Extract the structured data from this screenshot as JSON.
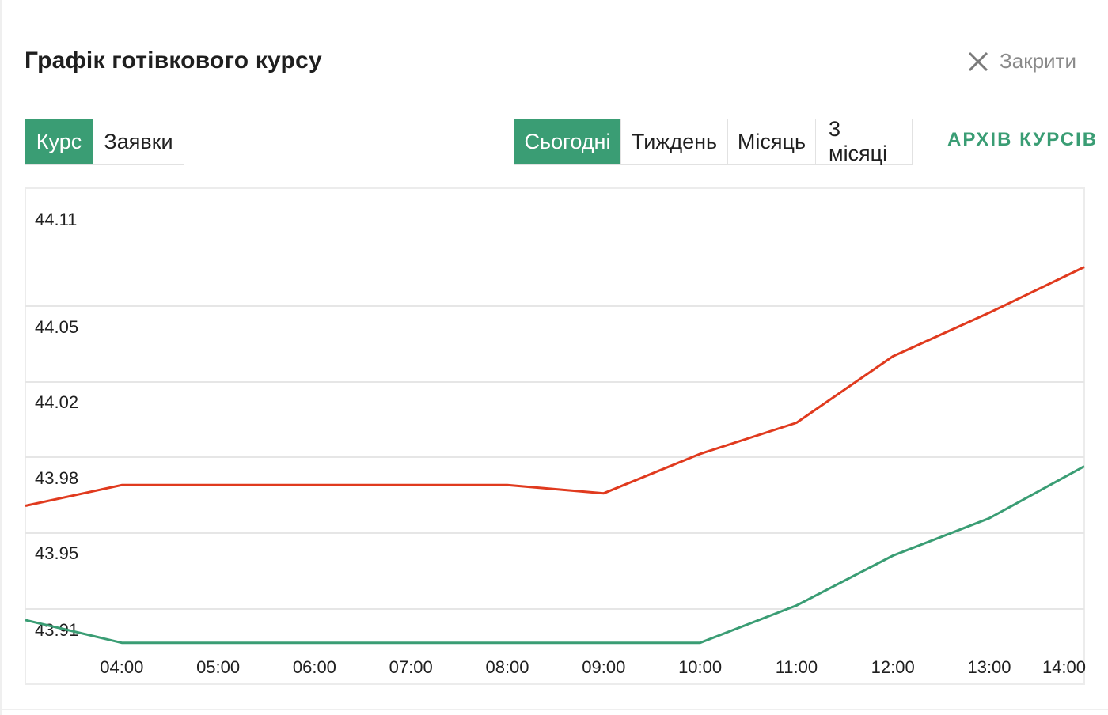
{
  "header": {
    "title": "Графік готівкового курсу",
    "close_label": "Закрити"
  },
  "type_tabs": [
    {
      "label": "Курс",
      "active": true
    },
    {
      "label": "Заявки",
      "active": false
    }
  ],
  "period_tabs": [
    {
      "label": "Сьогодні",
      "active": true
    },
    {
      "label": "Тиждень",
      "active": false
    },
    {
      "label": "Місяць",
      "active": false
    },
    {
      "label": "3 місяці",
      "active": false
    }
  ],
  "archive_link": "АРХІВ КУРСІВ",
  "colors": {
    "accent": "#3a9d74",
    "sell_line": "#e03a1e",
    "buy_line": "#3a9d74"
  },
  "chart_data": {
    "type": "line",
    "x": [
      "03:00",
      "04:00",
      "05:00",
      "06:00",
      "07:00",
      "08:00",
      "09:00",
      "10:00",
      "11:00",
      "12:00",
      "13:00",
      "14:00"
    ],
    "x_tick_labels": [
      "04:00",
      "05:00",
      "06:00",
      "07:00",
      "08:00",
      "09:00",
      "10:00",
      "11:00",
      "12:00",
      "13:00",
      "14:00"
    ],
    "y_tick_labels": [
      "44.11",
      "44.05",
      "44.02",
      "43.98",
      "43.95",
      "43.91"
    ],
    "series": [
      {
        "color": "#e03a1e",
        "values": [
          43.97,
          43.98,
          43.98,
          43.98,
          43.98,
          43.98,
          43.976,
          43.995,
          44.01,
          44.042,
          44.063,
          44.085
        ]
      },
      {
        "color": "#3a9d74",
        "values": [
          43.915,
          43.904,
          43.904,
          43.904,
          43.904,
          43.904,
          43.904,
          43.904,
          43.922,
          43.946,
          43.964,
          43.989
        ]
      }
    ],
    "grid": true,
    "title": "",
    "xlabel": "",
    "ylabel": ""
  }
}
